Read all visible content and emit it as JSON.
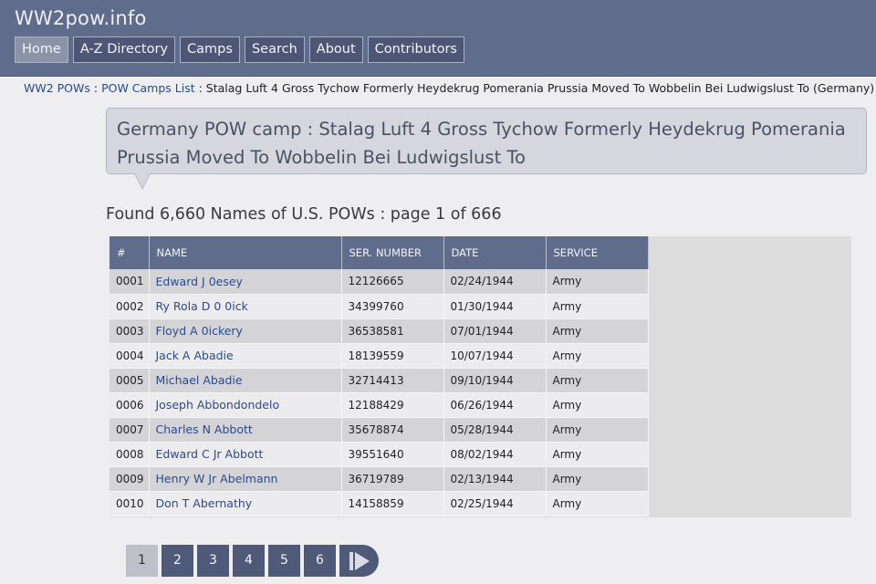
{
  "site_title": "WW2pow.info",
  "nav": [
    {
      "label": "Home"
    },
    {
      "label": "A-Z Directory"
    },
    {
      "label": "Camps"
    },
    {
      "label": "Search"
    },
    {
      "label": "About"
    },
    {
      "label": "Contributors"
    }
  ],
  "breadcrumb": {
    "link1": "WW2 POWs",
    "sep1": " : ",
    "link2": "POW Camps List",
    "sep2": " : ",
    "current": "Stalag Luft 4 Gross Tychow Formerly Heydekrug Pomerania Prussia Moved To Wobbelin Bei Ludwigslust To (Germany)"
  },
  "page_title": "Germany POW camp : Stalag Luft 4 Gross Tychow Formerly Heydekrug Pomerania Prussia Moved To Wobbelin Bei Ludwigslust To",
  "found_text": "Found 6,660 Names of U.S. POWs : page 1 of 666",
  "table": {
    "headers": [
      "#",
      "NAME",
      "SER. NUMBER",
      "DATE",
      "SERVICE"
    ],
    "rows": [
      {
        "num": "0001",
        "name": "Edward J 0esey",
        "serial": "12126665",
        "date": "02/24/1944",
        "service": "Army"
      },
      {
        "num": "0002",
        "name": "Ry Rola D 0 0ick",
        "serial": "34399760",
        "date": "01/30/1944",
        "service": "Army"
      },
      {
        "num": "0003",
        "name": "Floyd A 0ickery",
        "serial": "36538581",
        "date": "07/01/1944",
        "service": "Army"
      },
      {
        "num": "0004",
        "name": "Jack A Abadie",
        "serial": "18139559",
        "date": "10/07/1944",
        "service": "Army"
      },
      {
        "num": "0005",
        "name": "Michael Abadie",
        "serial": "32714413",
        "date": "09/10/1944",
        "service": "Army"
      },
      {
        "num": "0006",
        "name": "Joseph Abbondondelo",
        "serial": "12188429",
        "date": "06/26/1944",
        "service": "Army"
      },
      {
        "num": "0007",
        "name": "Charles N Abbott",
        "serial": "35678874",
        "date": "05/28/1944",
        "service": "Army"
      },
      {
        "num": "0008",
        "name": "Edward C Jr Abbott",
        "serial": "39551640",
        "date": "08/02/1944",
        "service": "Army"
      },
      {
        "num": "0009",
        "name": "Henry W Jr Abelmann",
        "serial": "36719789",
        "date": "02/13/1944",
        "service": "Army"
      },
      {
        "num": "0010",
        "name": "Don T Abernathy",
        "serial": "14158859",
        "date": "02/25/1944",
        "service": "Army"
      }
    ]
  },
  "pagination": {
    "pages": [
      "1",
      "2",
      "3",
      "4",
      "5",
      "6"
    ],
    "current": "1",
    "next_icon": "next-play-icon"
  },
  "colors": {
    "header_bg": "#5f6c8c",
    "nav_bg": "#4d5775",
    "link": "#2c4a8c",
    "page_bg": "#eeeef0"
  }
}
